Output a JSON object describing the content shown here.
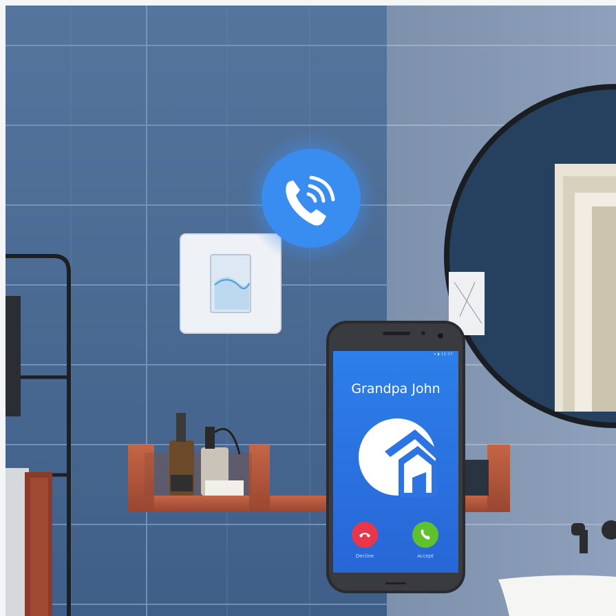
{
  "phone": {
    "status_bar": "▾ ▮ 12:17",
    "caller_name": "Grandpa John",
    "decline_label": "Decline",
    "accept_label": "Accept"
  },
  "icons": {
    "ringing": "phone-ringing-icon",
    "app_logo": "house-logo-icon",
    "decline": "phone-hangup-icon",
    "accept": "phone-icon"
  },
  "colors": {
    "wall_tile": "#4a6a94",
    "call_bubble": "#3a8df0",
    "phone_screen": "#2b74e2",
    "decline": "#e8364a",
    "accept": "#5fc22d",
    "shelf": "#b0553a"
  }
}
